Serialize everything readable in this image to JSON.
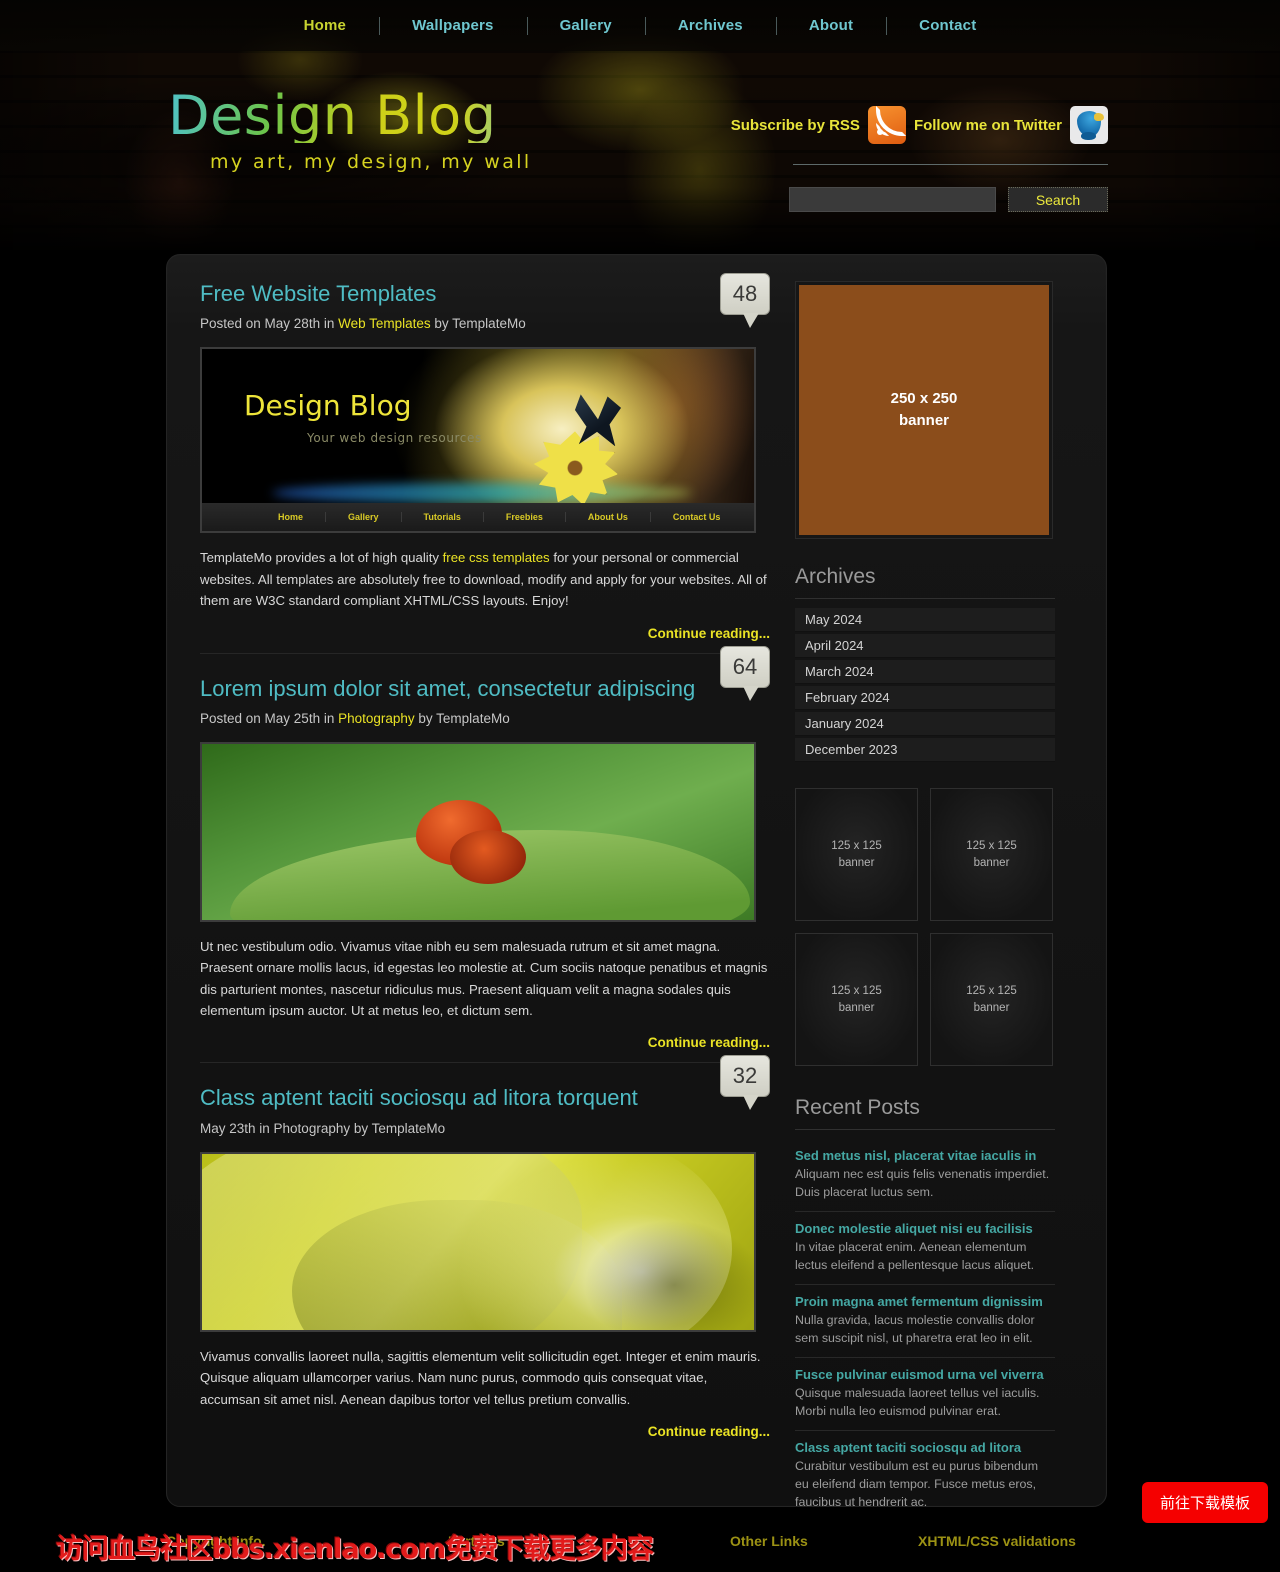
{
  "nav": {
    "items": [
      {
        "label": "Home",
        "active": true
      },
      {
        "label": "Wallpapers",
        "active": false
      },
      {
        "label": "Gallery",
        "active": false
      },
      {
        "label": "Archives",
        "active": false
      },
      {
        "label": "About",
        "active": false
      },
      {
        "label": "Contact",
        "active": false
      }
    ]
  },
  "header": {
    "logo": "Design Blog",
    "tagline": "my art, my design, my wall",
    "rss_label": "Subscribe by RSS",
    "twitter_label": "Follow me on Twitter",
    "rss_icon": "rss-icon",
    "twitter_icon": "twitter-bird-icon"
  },
  "search": {
    "value": "",
    "placeholder": "",
    "button_label": "Search"
  },
  "posts": [
    {
      "title": "Free Website Templates",
      "meta_prefix": "Posted on May 28th in ",
      "meta_link": "Web Templates",
      "meta_suffix": " by TemplateMo",
      "comments": "48",
      "image_type": "website-screenshot",
      "image_title": "Design Blog",
      "image_subtitle": "Your web design resources",
      "image_nav": [
        "Home",
        "Gallery",
        "Tutorials",
        "Freebies",
        "About Us",
        "Contact Us"
      ],
      "body_pre": "TemplateMo provides a lot of high quality ",
      "body_link": "free css templates",
      "body_post": " for your personal or commercial websites. All templates are absolutely free to download, modify and apply for your websites. All of them are W3C standard compliant XHTML/CSS layouts. Enjoy!",
      "continue_label": "Continue reading..."
    },
    {
      "title": "Lorem ipsum dolor sit amet, consectetur adipiscing",
      "meta_prefix": "Posted on May 25th in ",
      "meta_link": "Photography",
      "meta_suffix": " by TemplateMo",
      "comments": "64",
      "image_type": "red-beetle-on-leaf",
      "body": "Ut nec vestibulum odio. Vivamus vitae nibh eu sem malesuada rutrum et sit amet magna. Praesent ornare mollis lacus, id egestas leo molestie at. Cum sociis natoque penatibus et magnis dis parturient montes, nascetur ridiculus mus. Praesent aliquam velit a magna sodales quis elementum ipsum auctor. Ut at metus leo, et dictum sem.",
      "continue_label": "Continue reading..."
    },
    {
      "title": "Class aptent taciti sociosqu ad litora torquent",
      "meta_plain": "May 23th in Photography by TemplateMo",
      "comments": "32",
      "image_type": "yellow-rose-petal",
      "body": "Vivamus convallis laoreet nulla, sagittis elementum velit sollicitudin eget. Integer et enim mauris. Quisque aliquam ullamcorper varius. Nam nunc purus, commodo quis consequat vitae, accumsan sit amet nisl. Aenean dapibus tortor vel tellus pretium convallis.",
      "continue_label": "Continue reading..."
    }
  ],
  "sidebar": {
    "banner250": {
      "line1": "250 x 250",
      "line2": "banner",
      "color": "#8b4d1b"
    },
    "archives_title": "Archives",
    "archives": [
      "May 2024",
      "April 2024",
      "March 2024",
      "February 2024",
      "January 2024",
      "December 2023"
    ],
    "banners125": [
      {
        "line1": "125 x 125",
        "line2": "banner"
      },
      {
        "line1": "125 x 125",
        "line2": "banner"
      },
      {
        "line1": "125 x 125",
        "line2": "banner"
      },
      {
        "line1": "125 x 125",
        "line2": "banner"
      }
    ],
    "recent_title": "Recent Posts",
    "recent": [
      {
        "title": "Sed metus nisl, placerat vitae iaculis in",
        "desc": "Aliquam nec est quis felis venenatis imperdiet. Duis placerat luctus sem."
      },
      {
        "title": "Donec molestie aliquet nisi eu facilisis",
        "desc": "In vitae placerat enim. Aenean elementum lectus eleifend a pellentesque lacus aliquet."
      },
      {
        "title": "Proin magna amet fermentum dignissim",
        "desc": "Nulla gravida, lacus molestie convallis dolor sem suscipit nisl, ut pharetra erat leo in elit."
      },
      {
        "title": "Fusce pulvinar euismod urna vel viverra",
        "desc": "Quisque malesuada laoreet tellus vel iaculis. Morbi nulla leo euismod pulvinar erat."
      },
      {
        "title": "Class aptent taciti sociosqu ad litora",
        "desc": "Curabitur vestibulum est eu purus bibendum eu eleifend diam tempor. Fusce metus eros, faucibus ut hendrerit ac."
      }
    ]
  },
  "footer": {
    "col1": "Copyright info.",
    "col2": "Partners",
    "col3": "Other Links",
    "col4": "XHTML/CSS validations"
  },
  "overlay": {
    "watermark": "访问血鸟社区bbs.xienlao.com免费下载更多内容",
    "download_button": "前往下载模板"
  },
  "colors": {
    "nav_link": "#6fc7cf",
    "nav_active": "#c8d430",
    "accent_yellow": "#eae325",
    "post_title": "#4fbcc4",
    "recent_title": "#45a8a4",
    "footer_heading": "#9c9214",
    "watermark_red": "#e21b1b"
  }
}
